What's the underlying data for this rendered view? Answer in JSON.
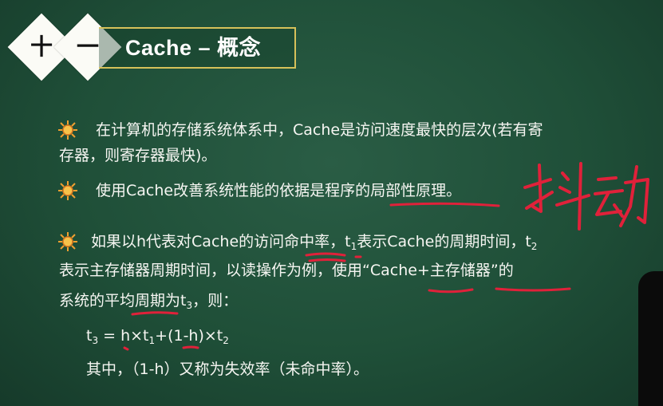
{
  "header": {
    "badge1": "十",
    "badge2": "一",
    "title": "Cache – 概念"
  },
  "bullets": {
    "b1_line1": "在计算机的存储系统体系中，Cache是访问速度最快的层次(若有寄",
    "b1_line2": "存器，则寄存器最快)。",
    "b2": "使用Cache改善系统性能的依据是程序的局部性原理。",
    "b3_line1_a": "如果以h代表对Cache的访问命中率，t",
    "b3_line1_sub1": "1",
    "b3_line1_b": "表示Cache的周期时间，t",
    "b3_line1_sub2": "2",
    "b3_line2": "表示主存储器周期时间，以读操作为例，使用“Cache+主存储器”的",
    "b3_line3_a": "系统的平均周期为t",
    "b3_line3_sub": "3",
    "b3_line3_b": "，则："
  },
  "formula": {
    "lhs": "t",
    "lhs_sub": "3",
    "rhs_a": " = h×t",
    "rhs_sub1": "1",
    "rhs_b": "+(1-h)×t",
    "rhs_sub2": "2"
  },
  "note": "其中，（1-h）又称为失效率（未命中率）。",
  "handwriting_text": "抖动",
  "colors": {
    "board": "#1f4f38",
    "header_border": "#d6c15a",
    "annotation": "#e0213a",
    "bullet": "#f0a030"
  }
}
